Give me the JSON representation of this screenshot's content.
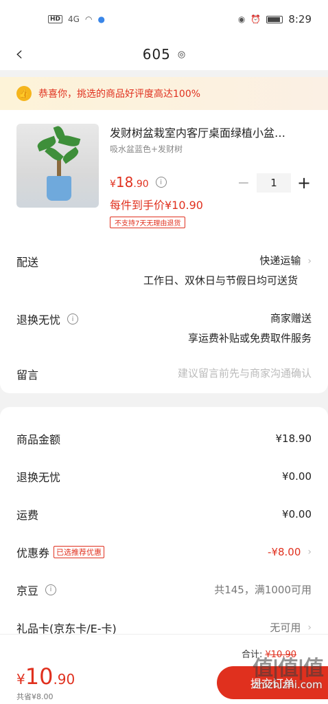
{
  "status_bar": {
    "hd": "HD",
    "signal": "4G",
    "time": "8:29"
  },
  "nav": {
    "title": "605"
  },
  "banner": {
    "text": "恭喜你，挑选的商品好评度高达100%"
  },
  "product": {
    "title": "发财树盆栽室内客厅桌面绿植小盆…",
    "variant": "吸水盆蓝色+发财树",
    "price_symbol": "¥",
    "price_int": "18",
    "price_dec": ".90",
    "quantity": "1",
    "net_price": "每件到手价¥10.90",
    "no_return_tag": "不支持7天无理由退货"
  },
  "delivery": {
    "label": "配送",
    "method": "快递运输",
    "schedule": "工作日、双休日与节假日均可送货"
  },
  "returns": {
    "label": "退换无忧",
    "provider": "商家赠送",
    "desc": "享运费补贴或免费取件服务"
  },
  "remark": {
    "label": "留言",
    "placeholder": "建议留言前先与商家沟通确认"
  },
  "summary": [
    {
      "label": "商品金额",
      "value": "¥18.90"
    },
    {
      "label": "退换无忧",
      "value": "¥0.00"
    },
    {
      "label": "运费",
      "value": "¥0.00"
    },
    {
      "label": "优惠券",
      "tag": "已选推荐优惠",
      "value": "-¥8.00"
    },
    {
      "label": "京豆",
      "value": "共145，满1000可用"
    },
    {
      "label": "礼品卡(京东卡/E-卡)",
      "value": "无可用"
    }
  ],
  "bottom": {
    "total_symbol": "¥",
    "total_int": "10",
    "total_dec": ".90",
    "saved": "共省¥8.00",
    "orig_label": "合计",
    "orig_value": "¥10.90",
    "submit_label": "提交订单"
  },
  "watermark": {
    "logo": "值|值|值",
    "text": "zhizhizhi.com"
  },
  "colors": {
    "accent": "#e0301e",
    "banner_bg": "#fdf3d8"
  }
}
